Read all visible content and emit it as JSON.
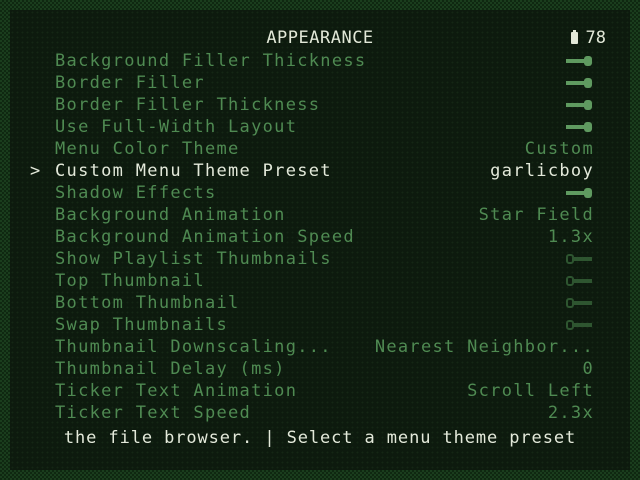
{
  "header": {
    "title": "APPEARANCE",
    "battery_level": "78",
    "battery_icon": "battery-icon"
  },
  "menu": {
    "cursor_symbol": ">",
    "items": [
      {
        "label": "Background Filler Thickness",
        "type": "toggle",
        "state": "on"
      },
      {
        "label": "Border Filler",
        "type": "toggle",
        "state": "on"
      },
      {
        "label": "Border Filler Thickness",
        "type": "toggle",
        "state": "on"
      },
      {
        "label": "Use Full-Width Layout",
        "type": "toggle",
        "state": "on"
      },
      {
        "label": "Menu Color Theme",
        "type": "text",
        "value": "Custom"
      },
      {
        "label": "Custom Menu Theme Preset",
        "type": "text",
        "value": "garlicboy",
        "selected": true
      },
      {
        "label": "Shadow Effects",
        "type": "toggle",
        "state": "on"
      },
      {
        "label": "Background Animation",
        "type": "text",
        "value": "Star Field"
      },
      {
        "label": "Background Animation Speed",
        "type": "text",
        "value": "1.3x"
      },
      {
        "label": "Show Playlist Thumbnails",
        "type": "toggle",
        "state": "off"
      },
      {
        "label": "Top Thumbnail",
        "type": "toggle",
        "state": "off"
      },
      {
        "label": "Bottom Thumbnail",
        "type": "toggle",
        "state": "off"
      },
      {
        "label": "Swap Thumbnails",
        "type": "toggle",
        "state": "off"
      },
      {
        "label": "Thumbnail Downscaling...",
        "type": "text",
        "value": "Nearest Neighbor..."
      },
      {
        "label": "Thumbnail Delay (ms)",
        "type": "text",
        "value": "0"
      },
      {
        "label": "Ticker Text Animation",
        "type": "text",
        "value": "Scroll Left"
      },
      {
        "label": "Ticker Text Speed",
        "type": "text",
        "value": "2.3x"
      }
    ]
  },
  "footer": {
    "help_text": "the file browser. | Select a menu theme preset"
  },
  "colors": {
    "selected_text": "#e3e9da",
    "unselected_text": "#4f8a52",
    "background": "#0d1a0e",
    "border": "#1a3d1d"
  }
}
